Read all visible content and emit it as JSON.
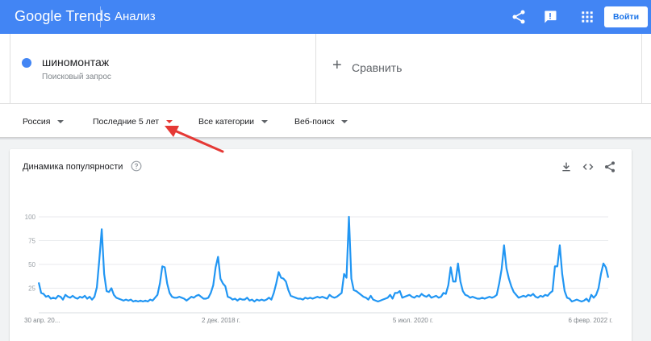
{
  "header": {
    "logo": "Google Trends",
    "title": "Анализ",
    "login_label": "Войти",
    "icons": [
      "share-icon",
      "feedback-icon",
      "apps-icon"
    ]
  },
  "term": {
    "name": "шиномонтаж",
    "type": "Поисковый запрос",
    "color": "#4285f4",
    "compare_label": "Сравнить"
  },
  "filters": [
    {
      "label": "Россия"
    },
    {
      "label": "Последние 5 лет",
      "highlight": true
    },
    {
      "label": "Все категории"
    },
    {
      "label": "Веб-поиск"
    }
  ],
  "card": {
    "title": "Динамика популярности",
    "icons": [
      "help-icon",
      "download-icon",
      "embed-icon",
      "share-icon"
    ]
  },
  "chart_data": {
    "type": "line",
    "ylim": [
      0,
      100
    ],
    "yticks": [
      "100",
      "75",
      "50",
      "25"
    ],
    "xticks": [
      "30 апр. 20...",
      "2 дек. 2018 г.",
      "5 июл. 2020 г.",
      "6 февр. 2022 г."
    ],
    "grid": true,
    "color": "#2196f3",
    "series": [
      {
        "values": [
          31,
          20,
          19,
          16,
          17,
          14,
          15,
          14,
          17,
          16,
          13,
          18,
          16,
          15,
          17,
          15,
          14,
          16,
          15,
          17,
          14,
          16,
          13,
          16,
          26,
          55,
          87,
          40,
          22,
          21,
          25,
          18,
          15,
          14,
          13,
          12,
          13,
          12,
          13,
          11,
          12,
          11,
          12,
          11,
          12,
          11,
          13,
          12,
          15,
          18,
          30,
          48,
          47,
          30,
          20,
          16,
          15,
          15,
          16,
          15,
          14,
          12,
          14,
          16,
          15,
          17,
          18,
          16,
          14,
          14,
          15,
          20,
          28,
          47,
          58,
          35,
          30,
          27,
          16,
          15,
          13,
          14,
          12,
          14,
          13,
          13,
          15,
          12,
          13,
          11,
          13,
          12,
          13,
          12,
          13,
          15,
          13,
          20,
          30,
          42,
          36,
          35,
          32,
          23,
          17,
          16,
          15,
          14,
          14,
          13,
          15,
          14,
          15,
          14,
          15,
          16,
          15,
          16,
          15,
          14,
          18,
          16,
          15,
          16,
          18,
          20,
          40,
          36,
          100,
          35,
          23,
          22,
          20,
          18,
          16,
          15,
          13,
          17,
          13,
          12,
          11,
          12,
          13,
          14,
          15,
          18,
          14,
          20,
          20,
          22,
          15,
          16,
          17,
          18,
          16,
          15,
          17,
          16,
          19,
          17,
          16,
          18,
          15,
          16,
          17,
          15,
          16,
          20,
          19,
          28,
          47,
          32,
          32,
          51,
          32,
          22,
          18,
          17,
          15,
          16,
          15,
          14,
          14,
          15,
          14,
          15,
          16,
          15,
          16,
          18,
          30,
          45,
          70,
          46,
          35,
          27,
          21,
          18,
          15,
          16,
          17,
          16,
          18,
          17,
          19,
          16,
          15,
          17,
          16,
          18,
          17,
          20,
          22,
          48,
          48,
          70,
          40,
          22,
          15,
          14,
          11,
          12,
          13,
          12,
          11,
          12,
          14,
          11,
          18,
          15,
          18,
          25,
          40,
          51,
          47,
          36
        ]
      }
    ]
  }
}
